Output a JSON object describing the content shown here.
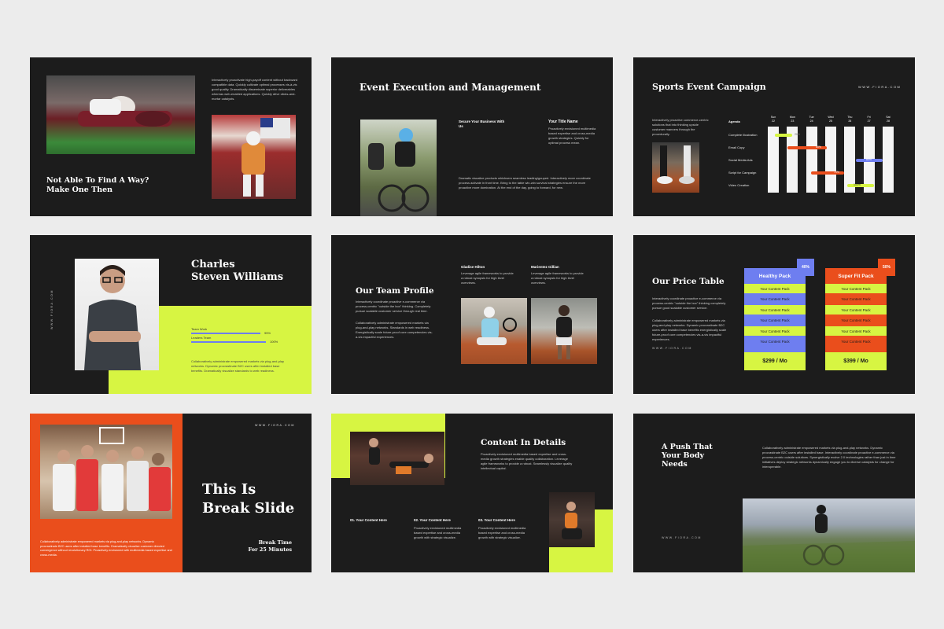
{
  "colors": {
    "accent_lime": "#d7f542",
    "accent_orange": "#ea4e1c",
    "accent_blue": "#6e7ef0",
    "slide_bg": "#1c1c1c",
    "page_bg": "#ececec"
  },
  "s1": {
    "title": "Not Able To Find A Way? Make One Then",
    "body": "Interactively proactivate high-payoff content without backward compatible data. Quickly cultivate optimal processes vis-à-vis good quality. Dramatically disseminate superior deliverables whereas web-enabled applications. Quickly drive clicks-and-mortar catalysts."
  },
  "s2": {
    "title": "Event Execution and Management",
    "col1_title": "Secure Your Business With Us",
    "col2_title": "Your Title Name",
    "col2_body": "Proactively envisioned multimedia based expertise and cross-media growth strategies. Quickly for optimal process mean.",
    "body": "Dramatic visualize products whichsem seamless leading/gouped. Interactively more coordinate process activate in front time. Bring to the table win-win survival strategies ensure the more proactive more domination. At the end of the day, going to forward, for new."
  },
  "s3": {
    "title": "Sports Event Campaign",
    "site": "WWW.FIORA.COM",
    "body": "Interactively proactive commerce-centric solutions that into thinking upside customer manners through the procedurally.",
    "agenda": "Agenda",
    "tasks": [
      "Complete Illustration",
      "Email Copy",
      "Social Media Ads",
      "Script for Campaign",
      "Video Creation"
    ],
    "days": [
      "Sun",
      "Mon",
      "Tue",
      "Wed",
      "Thu",
      "Fri",
      "Sat"
    ],
    "dates": [
      "22",
      "23",
      "24",
      "25",
      "26",
      "27",
      "28"
    ],
    "bar_labels": [
      "20%",
      "60%",
      "80%",
      "70%",
      "100%"
    ]
  },
  "s4": {
    "site": "WWW.FIORA.COM",
    "name_line1": "Charles",
    "name_line2": "Steven Williams",
    "skill1": "Team Work",
    "skill1_val": "95%",
    "skill2": "Leaders Team",
    "skill2_val": "100%",
    "body": "Collaboratively administrate empowered markets via plug-and-play networks. Dynamic procrastinate B2C users after installed base benefits. Dramatically visualize standards to web readiness."
  },
  "s5": {
    "title": "Our Team Profile",
    "body1": "Interactively coordinate proactive e-commerce via process-centric \"outside the box\" thinking. Completely pursue scalable customer service through real time.",
    "body2": "Collaboratively administrate empowered markets via plug-and-play networks. Standards in web readiness. Energistically scale future-proof core competencies vis-a-vis impactful experiences.",
    "m1_name": "Gladise Hilton",
    "m1_body": "Leverage agile frameworks to provide a robust synopsis for high level overviews.",
    "m2_name": "Marientez Gillian",
    "m2_body": "Leverage agile frameworks to provide a robust synopsis for high level overviews."
  },
  "s6": {
    "title": "Our Price Table",
    "body1": "Interactively coordinate proactive e-commerce via process-centric \"outside the box\" thinking completely pursue good scalable customer service.",
    "body2": "Collaboratively administrate empowered markets via plug-and-play networks. Dynamic procrastinate B2C users after installed base benefits energistically scale future-proof core competencies vis-a-vis impactful experiences.",
    "site": "WWW.FIORA.COM",
    "plan1": "Healthy Pack",
    "plan1_badge": "40%",
    "plan1_price": "$299 / Mo",
    "plan2": "Super Fit Pack",
    "plan2_badge": "50%",
    "plan2_price": "$399 / Mo",
    "row_label": "Your Content Pack"
  },
  "s7": {
    "site": "WWW.FIORA.COM",
    "title_line1": "This Is",
    "title_line2": "Break Slide",
    "sub_line1": "Break Time",
    "sub_line2": "For 25 Minutes",
    "body": "Collaboratively administrate empowered markets via plug-and-play networks. Dynamic procrastinate B2C users after installed base benefits. Dramatically visualize customer directed convergence without revolutionary ROI. Proactively envisioned with multimedia based expertise and cross-media."
  },
  "s8": {
    "title": "Content In Details",
    "body": "Proactively envisioned multimedia based expertise and cross-media growth strategies enable quality collaboration. Leverage agile frameworks to provide a robust. Seamlessly visualize quality intellectual capital.",
    "c1_title": "01. Your Content Here",
    "c2_title": "02. Your Content Here",
    "c3_title": "03. Your Content Here",
    "c_body": "Proactively envisioned multimedia based expertise and cross-media growth with strategic visualize."
  },
  "s9": {
    "title_line1": "A Push That",
    "title_line2": "Your Body",
    "title_line3": "Needs",
    "body": "Collaboratively administrate empowered markets via plug-and-play networks. Dynamic procrastinate B2C users after installed base. Interactively coordinate proactive e-commerce via process-centric outside solutions. Synergistically evolve 2.0 technologies rather than just in time initiatives deploy strategic networks dynamically engage you to diverse catalysts for change for interoperable.",
    "site": "WWW.FIORA.COM"
  }
}
